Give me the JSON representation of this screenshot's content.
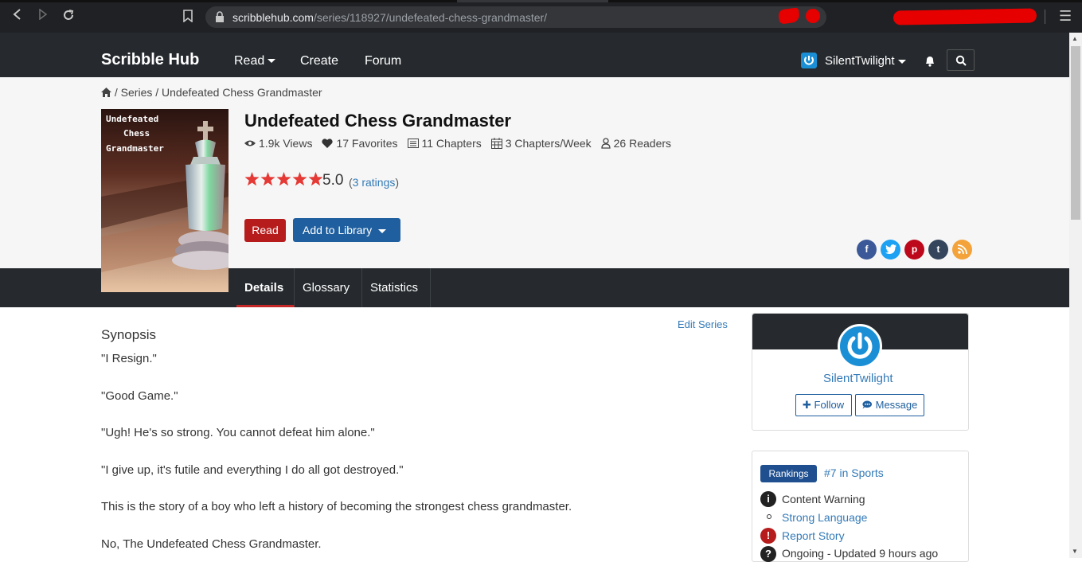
{
  "browser": {
    "url_host": "scribblehub.com",
    "url_path": "/series/118927/undefeated-chess-grandmaster/"
  },
  "header": {
    "logo": "Scribble Hub",
    "nav": [
      "Read",
      "Create",
      "Forum"
    ],
    "username": "SilentTwilight"
  },
  "breadcrumb": {
    "series": "Series",
    "current": "Undefeated Chess Grandmaster"
  },
  "cover": {
    "line1": "Undefeated",
    "line2": "Chess",
    "line3": "Grandmaster"
  },
  "series": {
    "title": "Undefeated Chess Grandmaster",
    "views": "1.9k Views",
    "favorites": "17 Favorites",
    "chapters": "11 Chapters",
    "per_week": "3 Chapters/Week",
    "readers": "26 Readers",
    "rating": "5.0",
    "rating_count_link": "3 ratings",
    "stars": 5
  },
  "buttons": {
    "read": "Read",
    "add_to_library": "Add to Library"
  },
  "share": [
    "f",
    "t",
    "p",
    "t",
    "rss"
  ],
  "tabs": [
    "Details",
    "Glossary",
    "Statistics"
  ],
  "content": {
    "edit_series": "Edit Series",
    "synopsis_heading": "Synopsis",
    "synopsis": [
      "\"I Resign.\"",
      "\"Good Game.\"",
      "\"Ugh! He's so strong. You cannot defeat him alone.\"",
      "\"I give up, it's futile and everything I do all got destroyed.\"",
      "This is the story of a boy who left a history of becoming the strongest chess grandmaster.",
      "No, The Undefeated Chess Grandmaster."
    ]
  },
  "author": {
    "name": "SilentTwilight",
    "follow": "Follow",
    "message": "Message"
  },
  "rankings": {
    "badge": "Rankings",
    "rank": "#7 in Sports",
    "content_warning": "Content Warning",
    "strong_language": "Strong Language",
    "report": "Report Story",
    "status": "Ongoing - Updated 9 hours ago"
  },
  "colors": {
    "header_bg": "#262a2e",
    "link": "#337ab7",
    "read_button": "#b71c1c",
    "library_button": "#1f5f9f",
    "star": "#e53935"
  }
}
